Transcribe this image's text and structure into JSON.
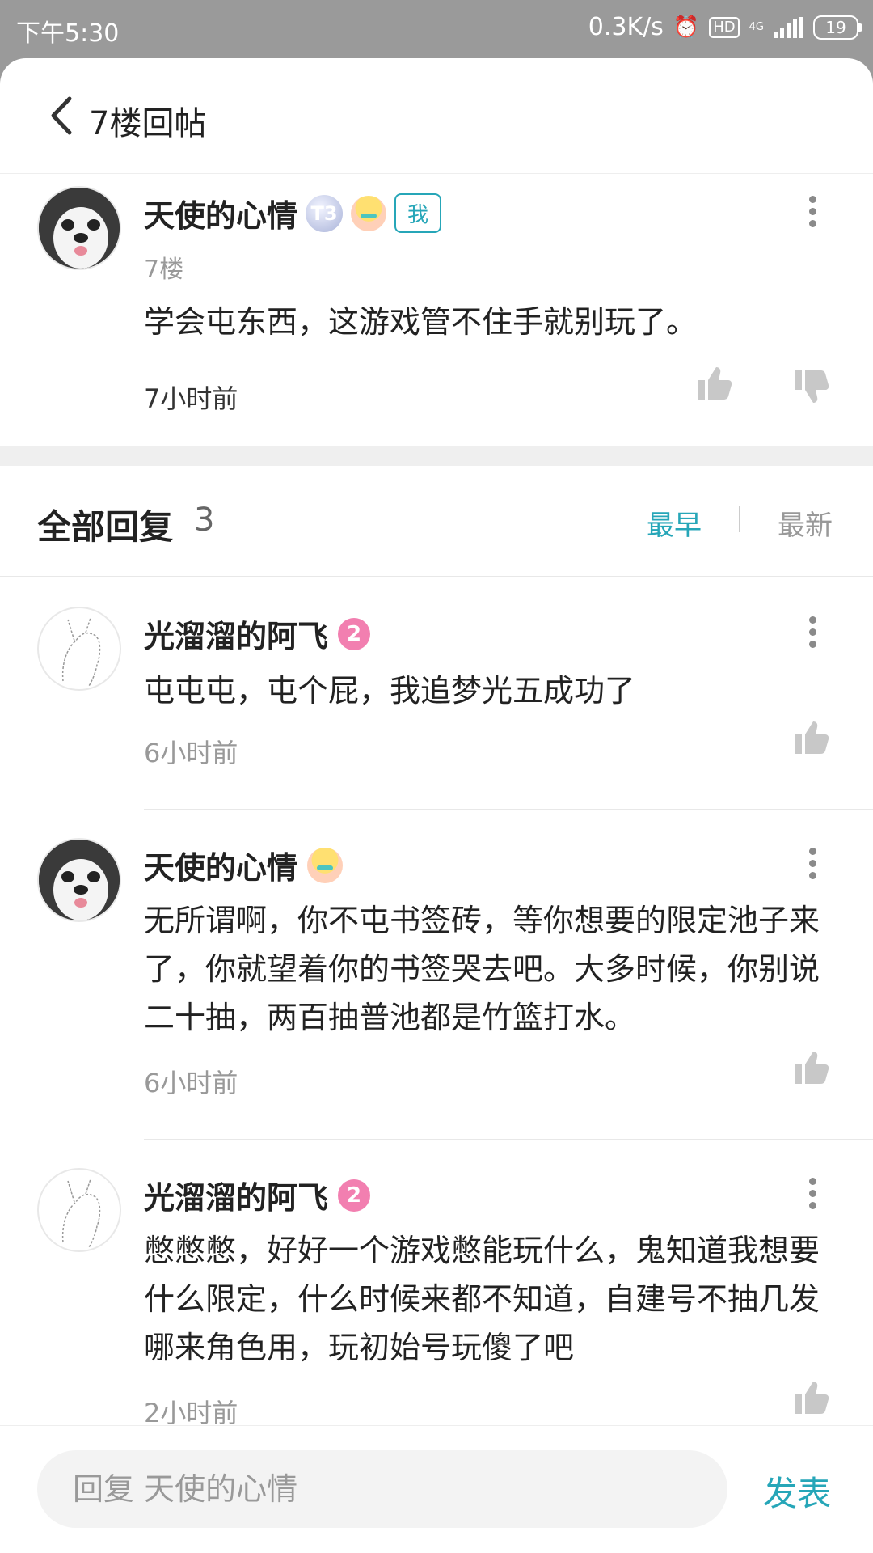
{
  "status_bar": {
    "time": "下午5:30",
    "net_speed": "0.3K/s",
    "hd": "HD",
    "network": "4G",
    "battery": "19"
  },
  "header": {
    "title": "7楼回帖"
  },
  "post": {
    "user": "天使的心情",
    "level_badge": "T3",
    "me_tag": "我",
    "floor": "7楼",
    "content": "学会屯东西，这游戏管不住手就别玩了。",
    "time": "7小时前"
  },
  "replies_header": {
    "title": "全部回复",
    "count": "3",
    "sort_earliest": "最早",
    "sort_newest": "最新"
  },
  "replies": [
    {
      "user": "光溜溜的阿飞",
      "level": "2",
      "content": "屯屯屯，屯个屁，我追梦光五成功了",
      "time": "6小时前"
    },
    {
      "user": "天使的心情",
      "content": "无所谓啊，你不屯书签砖，等你想要的限定池子来了，你就望着你的书签哭去吧。大多时候，你别说二十抽，两百抽普池都是竹篮打水。",
      "time": "6小时前"
    },
    {
      "user": "光溜溜的阿飞",
      "level": "2",
      "content": "憋憋憋，好好一个游戏憋能玩什么，鬼知道我想要什么限定，什么时候来都不知道，自建号不抽几发哪来角色用，玩初始号玩傻了吧",
      "time": "2小时前"
    }
  ],
  "footer": {
    "placeholder": "回复 天使的心情",
    "publish": "发表"
  },
  "colors": {
    "accent": "#26a6b8",
    "status_bar": "#9a9a9a"
  }
}
